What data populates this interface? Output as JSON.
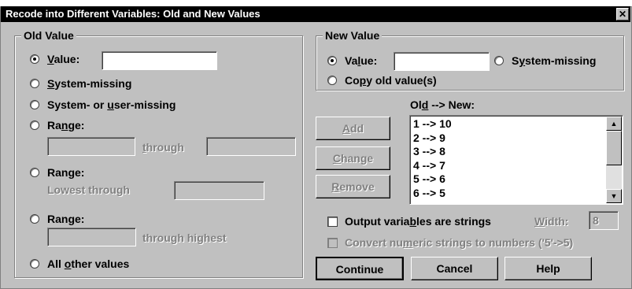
{
  "window": {
    "title": "Recode into Different Variables: Old and New Values",
    "close_glyph": "✕"
  },
  "old_value": {
    "legend": "Old Value",
    "value_label_pre": "",
    "value_label_u": "V",
    "value_label_post": "alue:",
    "value_input": "",
    "system_missing_u": "S",
    "system_missing_post": "ystem-missing",
    "sys_user_pre": "System- or ",
    "sys_user_u": "u",
    "sys_user_post": "ser-missing",
    "range1_pre": "Ra",
    "range1_u": "n",
    "range1_post": "ge:",
    "range1_from": "",
    "through_u": "t",
    "through_post": "hrough",
    "range1_to": "",
    "range2_label": "Range:",
    "lowest_through": "Lowest through",
    "range2_to": "",
    "range3_pre": "Ran",
    "range3_u": "g",
    "range3_post": "e:",
    "range3_from": "",
    "through_highest": "through highest",
    "all_other_pre": "All ",
    "all_other_u": "o",
    "all_other_post": "ther values",
    "selected": "value"
  },
  "new_value": {
    "legend": "New Value",
    "value_pre": "Va",
    "value_u": "l",
    "value_post": "ue:",
    "value_input": "",
    "sysmiss_pre": "S",
    "sysmiss_u": "y",
    "sysmiss_post": "stem-missing",
    "copy_pre": "Co",
    "copy_u": "p",
    "copy_post": "y old value(s)",
    "selected": "value"
  },
  "mapping": {
    "header_pre": "Ol",
    "header_u": "d",
    "header_post": " --> New:",
    "items": [
      "1 --> 10",
      "2 --> 9",
      "3 --> 8",
      "4 --> 7",
      "5 --> 6",
      "6 --> 5"
    ]
  },
  "buttons": {
    "add_u": "A",
    "add_post": "dd",
    "change_u": "C",
    "change_post": "hange",
    "remove_u": "R",
    "remove_post": "emove",
    "continue": "Continue",
    "cancel": "Cancel",
    "help": "Help"
  },
  "options": {
    "output_strings_pre": "Output varia",
    "output_strings_u": "b",
    "output_strings_post": "les are strings",
    "width_u": "W",
    "width_post": "idth:",
    "width_value": "8",
    "convert_pre": "Convert nu",
    "convert_u": "m",
    "convert_post": "eric strings to numbers ('5'->5)"
  }
}
